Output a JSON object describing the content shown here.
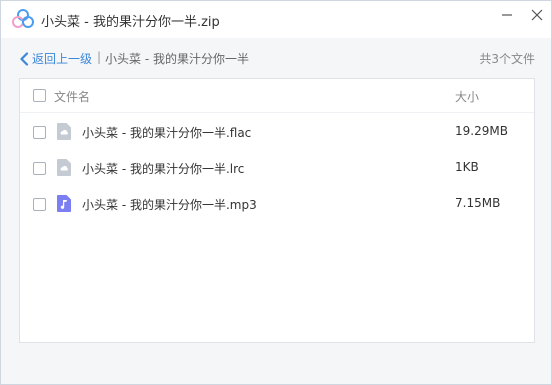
{
  "window": {
    "title": "小头菜 - 我的果汁分你一半.zip",
    "logo_icon": "cloud-logo-icon",
    "controls": {
      "minimize_icon": "minimize-icon",
      "close_icon": "close-icon"
    }
  },
  "nav": {
    "back_label": "返回上一级",
    "separator": "|",
    "current_folder": "小头菜 - 我的果汁分你一半",
    "item_count": "共3个文件"
  },
  "table": {
    "columns": {
      "name": "文件名",
      "size": "大小"
    },
    "rows": [
      {
        "name": "小头菜 - 我的果汁分你一半.flac",
        "size": "19.29MB",
        "icon": "audio-file-icon"
      },
      {
        "name": "小头菜 - 我的果汁分你一半.lrc",
        "size": "1KB",
        "icon": "generic-file-icon"
      },
      {
        "name": "小头菜 - 我的果汁分你一半.mp3",
        "size": "7.15MB",
        "icon": "music-file-icon"
      }
    ]
  },
  "colors": {
    "accent": "#3b87d8",
    "file_icon_gray": "#c4cbd3",
    "music_icon_purple": "#7b7ff2",
    "logo_blue": "#4a9df0",
    "logo_pink": "#f2a0c8"
  }
}
